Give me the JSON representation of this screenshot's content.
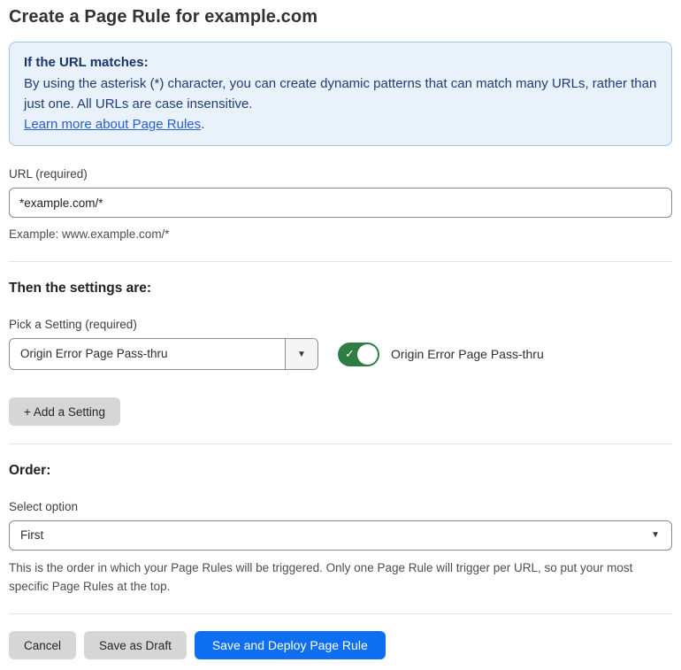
{
  "page": {
    "title": "Create a Page Rule for example.com"
  },
  "info_box": {
    "heading": "If the URL matches:",
    "body": "By using the asterisk (*) character, you can create dynamic patterns that can match many URLs, rather than just one. All URLs are case insensitive.",
    "link": "Learn more about Page Rules",
    "link_suffix": "."
  },
  "url_section": {
    "label": "URL (required)",
    "value": "*example.com/*",
    "helper": "Example: www.example.com/*"
  },
  "settings_section": {
    "heading": "Then the settings are:",
    "picker_label": "Pick a Setting (required)",
    "picker_value": "Origin Error Page Pass-thru",
    "toggle_state": "on",
    "toggle_label": "Origin Error Page Pass-thru",
    "add_button_label": "+ Add a Setting"
  },
  "order_section": {
    "heading": "Order:",
    "select_label": "Select option",
    "select_value": "First",
    "helper": "This is the order in which your Page Rules will be triggered. Only one Page Rule will trigger per URL, so put your most specific Page Rules at the top."
  },
  "footer": {
    "cancel_label": "Cancel",
    "save_draft_label": "Save as Draft",
    "save_deploy_label": "Save and Deploy Page Rule"
  },
  "icons": {
    "dropdown_arrow": "▼",
    "check": "✓"
  },
  "colors": {
    "accent_blue": "#0e70f0",
    "toggle_green": "#2e7d43",
    "info_bg": "#e9f1fb",
    "info_border": "#9fc4ee",
    "info_text": "#1f3e73",
    "info_heading": "#18346a",
    "link_blue": "#2a5fd1"
  }
}
